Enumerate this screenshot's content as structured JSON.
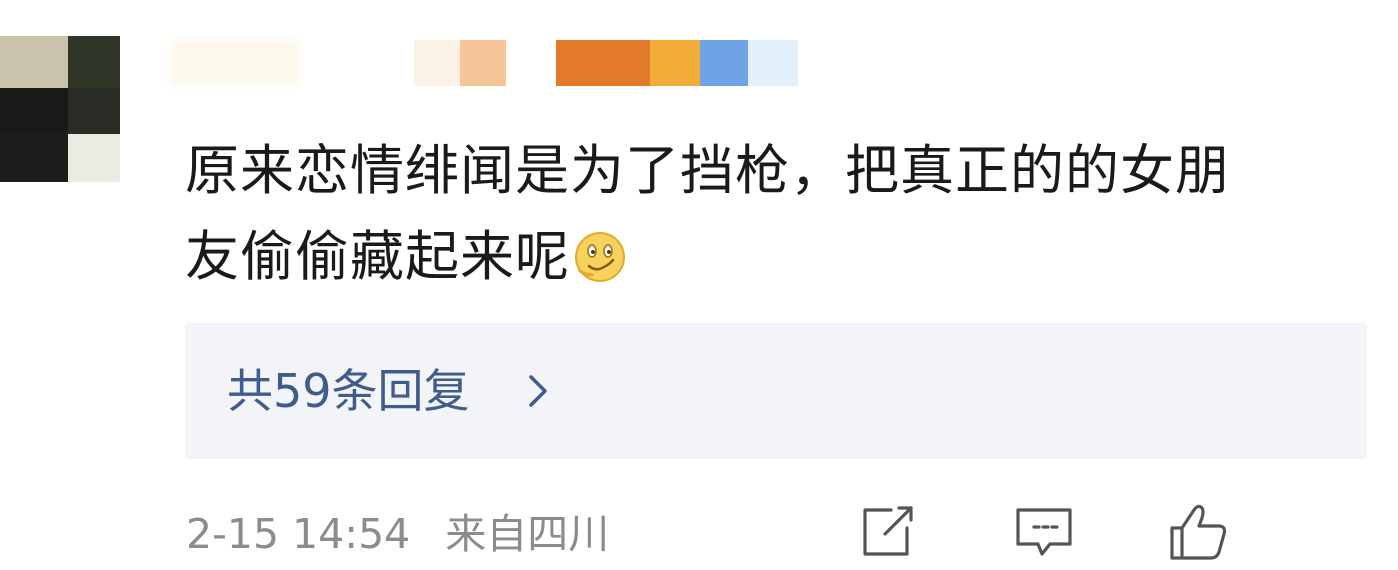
{
  "comment": {
    "text_line1": "原来恋情绯闻是为了挡枪，把真正的的女朋",
    "text_line2": "友偷偷藏起来呢",
    "emoji": "smirk-emoji"
  },
  "replies": {
    "label": "共59条回复"
  },
  "meta": {
    "date_time": "2-15 14:54",
    "location": "来自四川"
  },
  "actions": {
    "share_icon": "share-icon",
    "comment_icon": "comment-icon",
    "like_icon": "thumbs-up-icon"
  },
  "colors": {
    "reply_link": "#3f5c8c",
    "reply_bg": "#f2f4f8",
    "meta_gray": "#8c8c8c",
    "text": "#1a1a1a"
  }
}
